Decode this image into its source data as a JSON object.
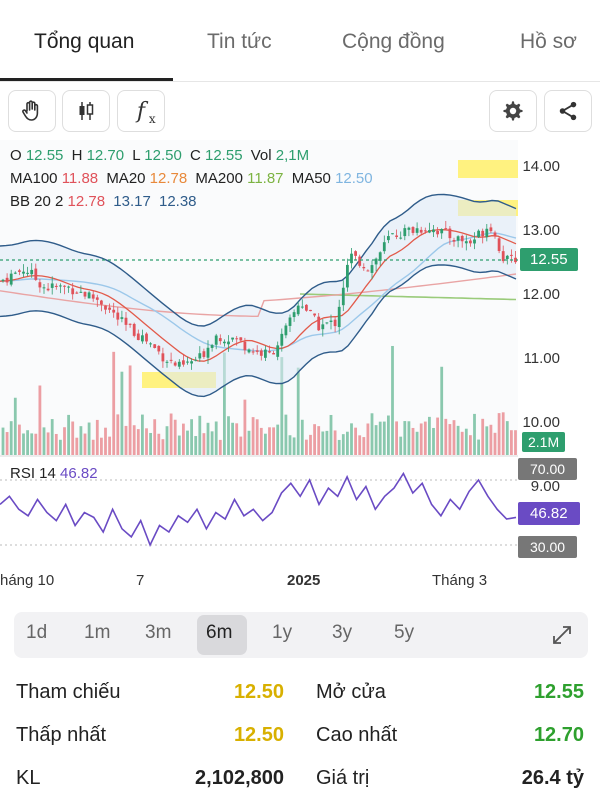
{
  "tabs": [
    {
      "label": "Tổng quan",
      "active": true
    },
    {
      "label": "Tin tức",
      "active": false
    },
    {
      "label": "Cộng đồng",
      "active": false
    },
    {
      "label": "Hồ sơ",
      "active": false
    }
  ],
  "toolbar": {
    "icons": [
      "hand-icon",
      "candlestick-icon",
      "function-icon",
      "settings-icon",
      "share-icon"
    ],
    "function_label": "f",
    "function_sub": "x"
  },
  "legend": {
    "ohlc": {
      "o_label": "O",
      "o": "12.55",
      "h_label": "H",
      "h": "12.70",
      "l_label": "L",
      "l": "12.50",
      "c_label": "C",
      "c": "12.55",
      "vol_label": "Vol",
      "vol": "2,1M"
    },
    "ma": {
      "ma100_label": "MA100",
      "ma100": "11.88",
      "ma20_label": "MA20",
      "ma20": "12.78",
      "ma200_label": "MA200",
      "ma200": "11.87",
      "ma50_label": "MA50",
      "ma50": "12.50"
    },
    "bb": {
      "label": "BB 20 2",
      "v1": "12.78",
      "v2": "13.17",
      "v3": "12.38"
    }
  },
  "price_axis": [
    "14.00",
    "13.00",
    "12.00",
    "11.00",
    "10.00",
    "9.00"
  ],
  "current_price": "12.55",
  "volume_tag": "2.1M",
  "rsi": {
    "label": "RSI 14",
    "value": "46.82",
    "upper": "70.00",
    "lower": "30.00"
  },
  "x_axis": [
    "háng 10",
    "7",
    "2025",
    "Tháng 3"
  ],
  "ranges": [
    "1d",
    "1m",
    "3m",
    "6m",
    "1y",
    "3y",
    "5y"
  ],
  "selected_range": "6m",
  "stats": {
    "ref_label": "Tham chiếu",
    "ref_value": "12.50",
    "open_label": "Mở cửa",
    "open_value": "12.55",
    "low_label": "Thấp nhất",
    "low_value": "12.50",
    "high_label": "Cao nhất",
    "high_value": "12.70",
    "vol_label": "KL",
    "vol_value": "2,102,800",
    "val_label": "Giá trị",
    "val_value": "26.4 tỷ"
  },
  "colors": {
    "up": "#2e9e6e",
    "down": "#e0525a",
    "yellow": "#d8b000",
    "green_text": "#2ea02e",
    "purple": "#6a4bc4",
    "ma20": "#e8893b",
    "bb_band": "#2f5c8a"
  }
}
